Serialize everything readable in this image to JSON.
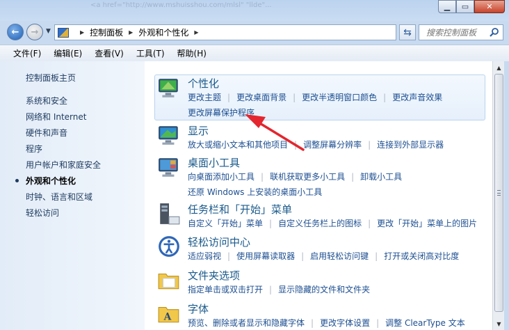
{
  "titlebar": {
    "background_text": "<a href=\"http://www.mshuisshou.com/mlsl\" \"llde\"..."
  },
  "breadcrumb": [
    "控制面板",
    "外观和个性化"
  ],
  "search": {
    "placeholder": "搜索控制面板"
  },
  "menu": [
    "文件(F)",
    "编辑(E)",
    "查看(V)",
    "工具(T)",
    "帮助(H)"
  ],
  "sidebar": {
    "home": "控制面板主页",
    "items": [
      {
        "label": "系统和安全"
      },
      {
        "label": "网络和 Internet"
      },
      {
        "label": "硬件和声音"
      },
      {
        "label": "程序"
      },
      {
        "label": "用户帐户和家庭安全"
      },
      {
        "label": "外观和个性化",
        "current": true
      },
      {
        "label": "时钟、语言和区域"
      },
      {
        "label": "轻松访问"
      }
    ]
  },
  "categories": [
    {
      "title": "个性化",
      "icon": "personalization-icon",
      "highlighted": true,
      "rows": [
        [
          "更改主题",
          "更改桌面背景",
          "更改半透明窗口颜色",
          "更改声音效果"
        ],
        [
          "更改屏幕保护程序"
        ]
      ]
    },
    {
      "title": "显示",
      "icon": "display-icon",
      "rows": [
        [
          "放大或缩小文本和其他项目",
          "调整屏幕分辨率",
          "连接到外部显示器"
        ]
      ]
    },
    {
      "title": "桌面小工具",
      "icon": "gadgets-icon",
      "rows": [
        [
          "向桌面添加小工具",
          "联机获取更多小工具",
          "卸载小工具"
        ],
        [
          "还原 Windows 上安装的桌面小工具"
        ]
      ]
    },
    {
      "title": "任务栏和「开始」菜单",
      "icon": "taskbar-icon",
      "rows": [
        [
          "自定义「开始」菜单",
          "自定义任务栏上的图标",
          "更改「开始」菜单上的图片"
        ]
      ]
    },
    {
      "title": "轻松访问中心",
      "icon": "ease-of-access-icon",
      "rows": [
        [
          "适应弱视",
          "使用屏幕读取器",
          "启用轻松访问键",
          "打开或关闭高对比度"
        ]
      ]
    },
    {
      "title": "文件夹选项",
      "icon": "folder-options-icon",
      "rows": [
        [
          "指定单击或双击打开",
          "显示隐藏的文件和文件夹"
        ]
      ]
    },
    {
      "title": "字体",
      "icon": "fonts-icon",
      "rows": [
        [
          "预览、删除或者显示和隐藏字体",
          "更改字体设置",
          "调整 ClearType 文本"
        ]
      ]
    }
  ],
  "colors": {
    "link": "#1d4f91",
    "title": "#1a5a8b",
    "annotation_arrow": "#e3262f"
  }
}
